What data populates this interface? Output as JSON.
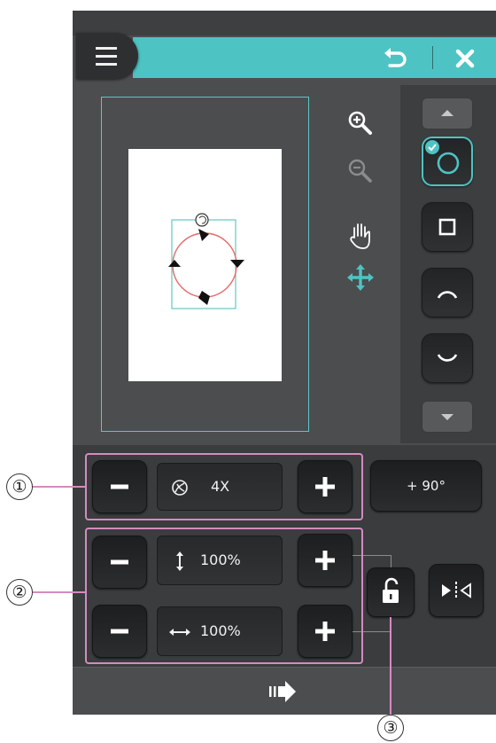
{
  "header": {
    "menu_icon": "hamburger-menu-icon",
    "undo_icon": "undo-arrow-icon",
    "close_icon": "close-x-icon",
    "accent_color": "#4ec3c3"
  },
  "canvas_tools": [
    {
      "name": "zoom-in",
      "icon": "zoom-in-icon",
      "enabled": true
    },
    {
      "name": "zoom-out",
      "icon": "zoom-out-icon",
      "enabled": false
    },
    {
      "name": "pan",
      "icon": "hand-pan-icon",
      "enabled": true
    },
    {
      "name": "move",
      "icon": "move-arrows-icon",
      "enabled": true,
      "active": true
    }
  ],
  "shape_list": [
    {
      "name": "circle",
      "icon": "circle-shape-icon",
      "selected": true
    },
    {
      "name": "square",
      "icon": "square-shape-icon",
      "selected": false
    },
    {
      "name": "arc-top",
      "icon": "arc-top-shape-icon",
      "selected": false
    },
    {
      "name": "arc-bottom",
      "icon": "arc-bottom-shape-icon",
      "selected": false
    }
  ],
  "controls": {
    "repeat": {
      "icon": "repeat-pattern-icon",
      "value": "4X"
    },
    "rotate_label": "+ 90°",
    "height": {
      "icon": "vertical-arrow-icon",
      "value": "100%"
    },
    "width": {
      "icon": "horizontal-arrow-icon",
      "value": "100%"
    },
    "lock_icon": "padlock-open-icon",
    "mirror_icon": "mirror-horizontal-icon"
  },
  "footer": {
    "next_icon": "next-arrow-icon"
  },
  "callouts": [
    "①",
    "②",
    "③"
  ]
}
